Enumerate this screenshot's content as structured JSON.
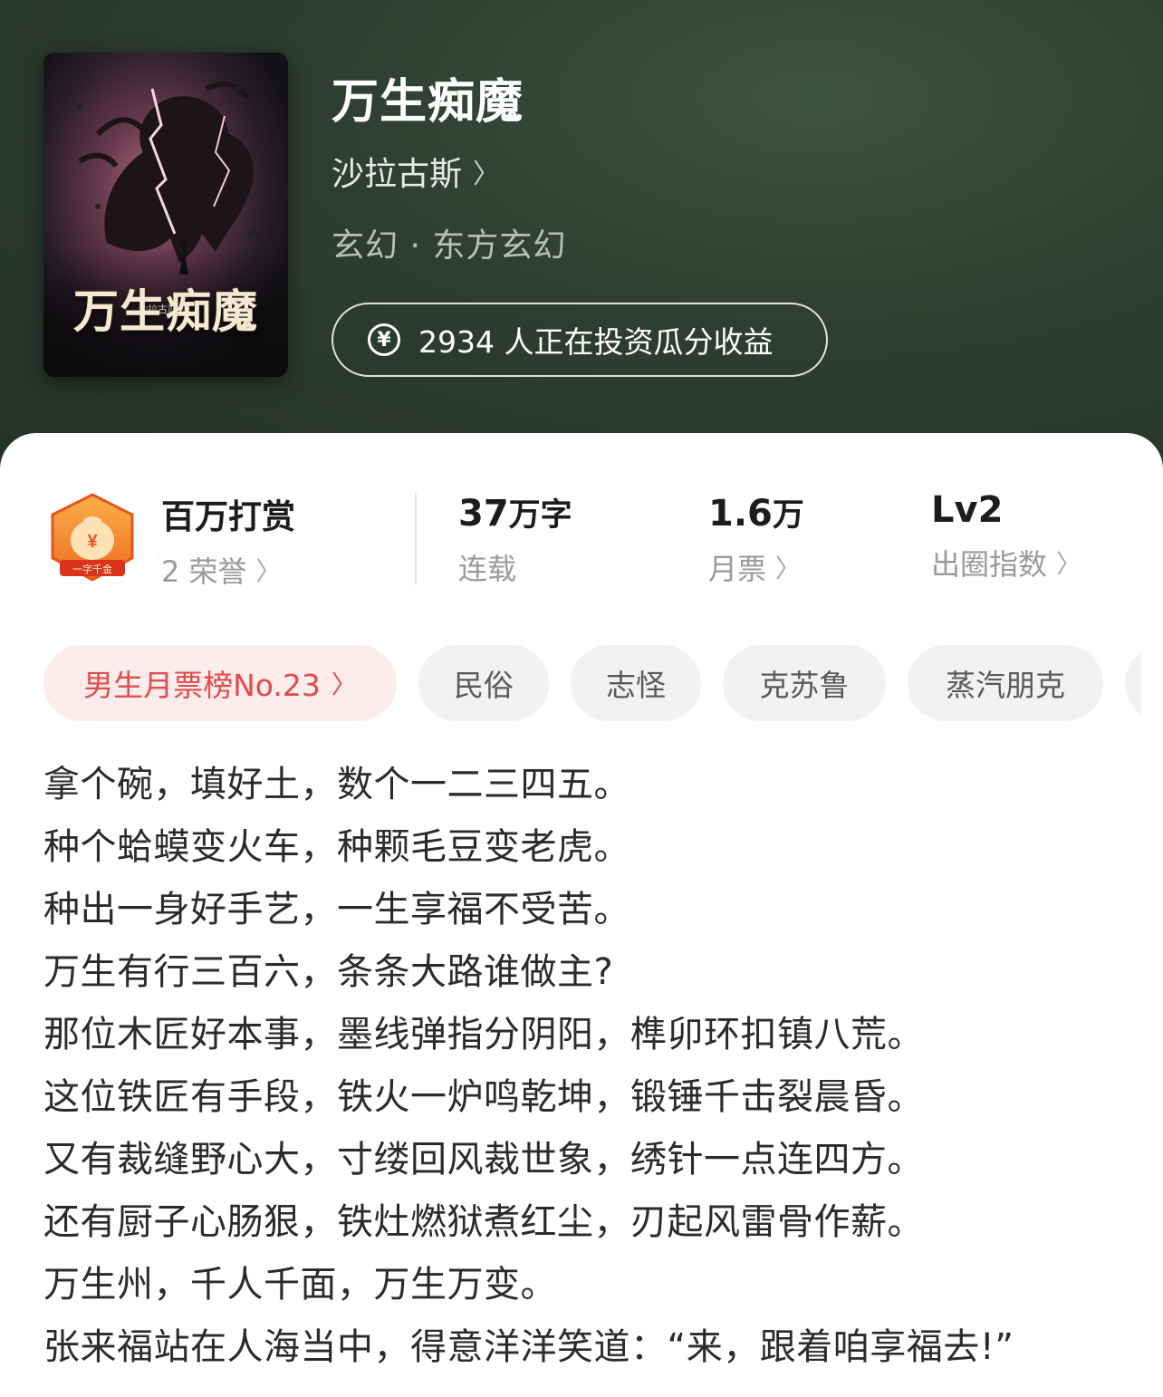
{
  "book": {
    "title": "万生痴魔",
    "author": "沙拉古斯",
    "genre": "玄幻 · 东方玄幻",
    "invest_text": "2934 人正在投资瓜分收益",
    "cover": {
      "author_text": "沙拉古斯 著",
      "title_text": "万生痴魔"
    }
  },
  "stats": {
    "reward": {
      "title": "百万打赏",
      "sub": "2 荣誉"
    },
    "words": {
      "value": "37",
      "unit": "万字",
      "sub": "连载"
    },
    "tickets": {
      "value": "1.6",
      "unit": "万",
      "sub": "月票"
    },
    "level": {
      "value": "Lv2",
      "sub": "出圈指数"
    },
    "badge_text": "一字千金"
  },
  "tags": [
    {
      "label": "男生月票榜No.23",
      "type": "rank"
    },
    {
      "label": "民俗",
      "type": "normal"
    },
    {
      "label": "志怪",
      "type": "normal"
    },
    {
      "label": "克苏鲁",
      "type": "normal"
    },
    {
      "label": "蒸汽朋克",
      "type": "normal"
    }
  ],
  "synopsis": [
    "拿个碗，填好土，数个一二三四五。",
    "种个蛤蟆变火车，种颗毛豆变老虎。",
    "种出一身好手艺，一生享福不受苦。",
    "万生有行三百六，条条大路谁做主?",
    "那位木匠好本事，墨线弹指分阴阳，榫卯环扣镇八荒。",
    "这位铁匠有手段，铁火一炉鸣乾坤，锻锤千击裂晨昏。",
    "又有裁缝野心大，寸缕回风裁世象，绣针一点连四方。",
    "还有厨子心肠狠，铁灶燃狱煮红尘，刃起风雷骨作薪。",
    "万生州，千人千面，万生万变。",
    "张来福站在人海当中，得意洋洋笑道：“来，跟着咱享福去!”"
  ],
  "colors": {
    "header_bg": "#2d3d31",
    "rank_tag_bg": "#fdecec",
    "rank_tag_text": "#e44a4a",
    "badge_orange": "#f07a28"
  }
}
